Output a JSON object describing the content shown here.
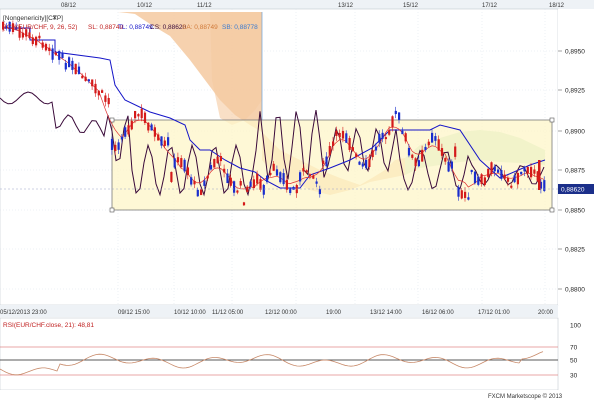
{
  "window": {
    "title_tab": "[Nongenericity][CTP]",
    "footer": "FXCM Marketscope © 2013"
  },
  "indicator_header": {
    "name": "[ICH(EUR/CHF, 9, 26, 52)",
    "sl": "SL: 0,88749",
    "tl": "TL: 0,88749",
    "cs": "CS: 0,88620",
    "sa": "SA: 0,88749",
    "sb": "SB: 0,88778"
  },
  "rsi_header": "RSI(EUR/CHF.close, 21): 48,81",
  "top_dates": [
    "08/12",
    "10/12",
    "11/12",
    "13/12",
    "15/12",
    "17/12",
    "18/12"
  ],
  "bottom_times": [
    "05/12/2013 23:00",
    "09/12 15:00",
    "10/12 10:00",
    "11/12 05:00",
    "12/12 00:00",
    "19:00",
    "13/12 14:00",
    "16/12 06:00",
    "17/12 01:00",
    "20:00"
  ],
  "price_axis": [
    "0,8950",
    "0,8925",
    "0,8900",
    "0,8875",
    "0,8850",
    "0,8825",
    "0,8800"
  ],
  "current_price": "0,88620",
  "rsi_axis": [
    "100",
    "70",
    "50",
    "30"
  ],
  "colors": {
    "bull": "#1a2ecc",
    "bear": "#d41a1a",
    "kijun": "#1515c8",
    "tenkan": "#e03030",
    "chikou": "#3a0a3a",
    "kumo_bear": "#f5c9a0",
    "kumo_bull": "#c8e8c8",
    "box_fill": "#fdf6c8",
    "box_border": "#7a7a7a",
    "rsi_line": "#c88a6a"
  },
  "icons": {
    "event_markers": "orange-triangle-down",
    "close_icon": "close-x"
  }
}
